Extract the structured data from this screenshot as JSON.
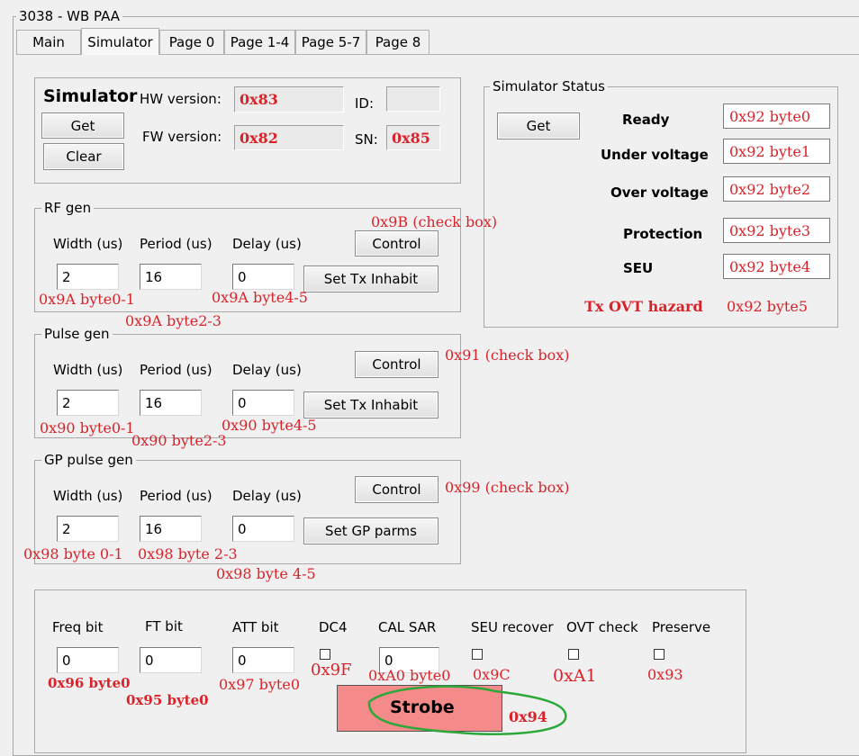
{
  "window": {
    "title": "3038 - WB PAA"
  },
  "tabs": [
    "Main",
    "Simulator",
    "Page 0",
    "Page 1-4",
    "Page 5-7",
    "Page 8"
  ],
  "simulator": {
    "title": "Simulator",
    "get_label": "Get",
    "clear_label": "Clear",
    "hw_label": "HW version:",
    "hw_value": "0x83",
    "fw_label": "FW version:",
    "fw_value": "0x82",
    "id_label": "ID:",
    "id_value": "",
    "sn_label": "SN:",
    "sn_value": "0x85"
  },
  "status": {
    "title": "Simulator Status",
    "get_label": "Get",
    "rows": [
      {
        "label": "Ready",
        "value": "0x92 byte0"
      },
      {
        "label": "Under voltage",
        "value": "0x92 byte1"
      },
      {
        "label": "Over voltage",
        "value": "0x92 byte2"
      },
      {
        "label": "Protection",
        "value": "0x92 byte3"
      },
      {
        "label": "SEU",
        "value": "0x92 byte4"
      }
    ],
    "hazard_label": "Tx OVT hazard",
    "hazard_value": "0x92 byte5"
  },
  "rf_gen": {
    "title": "RF gen",
    "width_label": "Width (us)",
    "period_label": "Period (us)",
    "delay_label": "Delay (us)",
    "width": "2",
    "period": "16",
    "delay": "0",
    "control_label": "Control",
    "action_label": "Set Tx Inhabit",
    "ann_control": "0x9B (check box)",
    "ann_width": "0x9A byte0-1",
    "ann_period": "0x9A byte2-3",
    "ann_delay": "0x9A byte4-5"
  },
  "pulse_gen": {
    "title": "Pulse gen",
    "width_label": "Width (us)",
    "period_label": "Period (us)",
    "delay_label": "Delay (us)",
    "width": "2",
    "period": "16",
    "delay": "0",
    "control_label": "Control",
    "action_label": "Set Tx Inhabit",
    "ann_control": "0x91 (check box)",
    "ann_width": "0x90 byte0-1",
    "ann_period": "0x90 byte2-3",
    "ann_delay": "0x90 byte4-5"
  },
  "gp_pulse_gen": {
    "title": "GP pulse gen",
    "width_label": "Width (us)",
    "period_label": "Period (us)",
    "delay_label": "Delay (us)",
    "width": "2",
    "period": "16",
    "delay": "0",
    "control_label": "Control",
    "action_label": "Set GP parms",
    "ann_control": "0x99 (check box)",
    "ann_width": "0x98 byte 0-1",
    "ann_period": "0x98 byte 2-3",
    "ann_delay": "0x98 byte 4-5"
  },
  "bottom": {
    "freq_label": "Freq bit",
    "freq_value": "0",
    "freq_ann": "0x96 byte0",
    "ft_label": "FT bit",
    "ft_value": "0",
    "ft_ann": "0x95 byte0",
    "att_label": "ATT bit",
    "att_value": "0",
    "att_ann": "0x97 byte0",
    "dc4_label": "DC4",
    "dc4_ann": "0x9F",
    "cal_label": "CAL SAR",
    "cal_value": "0",
    "cal_ann": "0xA0 byte0",
    "seu_label": "SEU recover",
    "seu_ann": "0x9C",
    "ovt_label": "OVT check",
    "ovt_ann": "0xA1",
    "preserve_label": "Preserve",
    "preserve_ann": "0x93",
    "strobe_label": "Strobe",
    "strobe_ann": "0x94"
  },
  "colors": {
    "annotation": "#d9232a",
    "strobe": "#f48a8a",
    "highlight_circle": "#2ea83a"
  }
}
